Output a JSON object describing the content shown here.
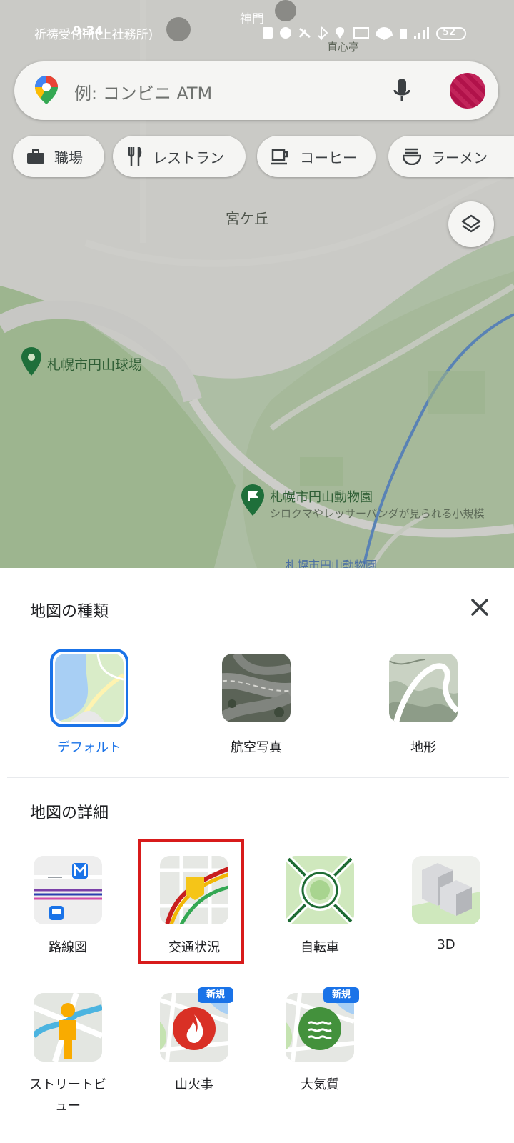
{
  "status_bar": {
    "time": "9:34",
    "battery": "52"
  },
  "map": {
    "labels": {
      "top_left": "祈祷受付所(上社務所)",
      "shrine_gate": "神門",
      "naoshintei": "直心亭",
      "district": "宮ケ丘",
      "stadium": "札幌市円山球場",
      "zoo": "札幌市円山動物園",
      "zoo_desc": "シロクマやレッサーパンダが見られる小規模",
      "zoo_bottom": "札幌市円山動物園"
    }
  },
  "search": {
    "placeholder": "例: コンビニ ATM"
  },
  "chips": [
    "職場",
    "レストラン",
    "コーヒー",
    "ラーメン"
  ],
  "sheet": {
    "map_type_title": "地図の種類",
    "map_types": [
      {
        "label": "デフォルト",
        "selected": true
      },
      {
        "label": "航空写真",
        "selected": false
      },
      {
        "label": "地形",
        "selected": false
      }
    ],
    "details_title": "地図の詳細",
    "details": [
      {
        "label": "路線図"
      },
      {
        "label": "交通状況",
        "highlighted": true
      },
      {
        "label": "自転車"
      },
      {
        "label": "3D"
      },
      {
        "label": "ストリートビュー"
      },
      {
        "label": "山火事",
        "badge": "新規"
      },
      {
        "label": "大気質",
        "badge": "新規"
      }
    ]
  },
  "colors": {
    "accent": "#1a73e8",
    "highlight_box": "#d81b1b"
  }
}
